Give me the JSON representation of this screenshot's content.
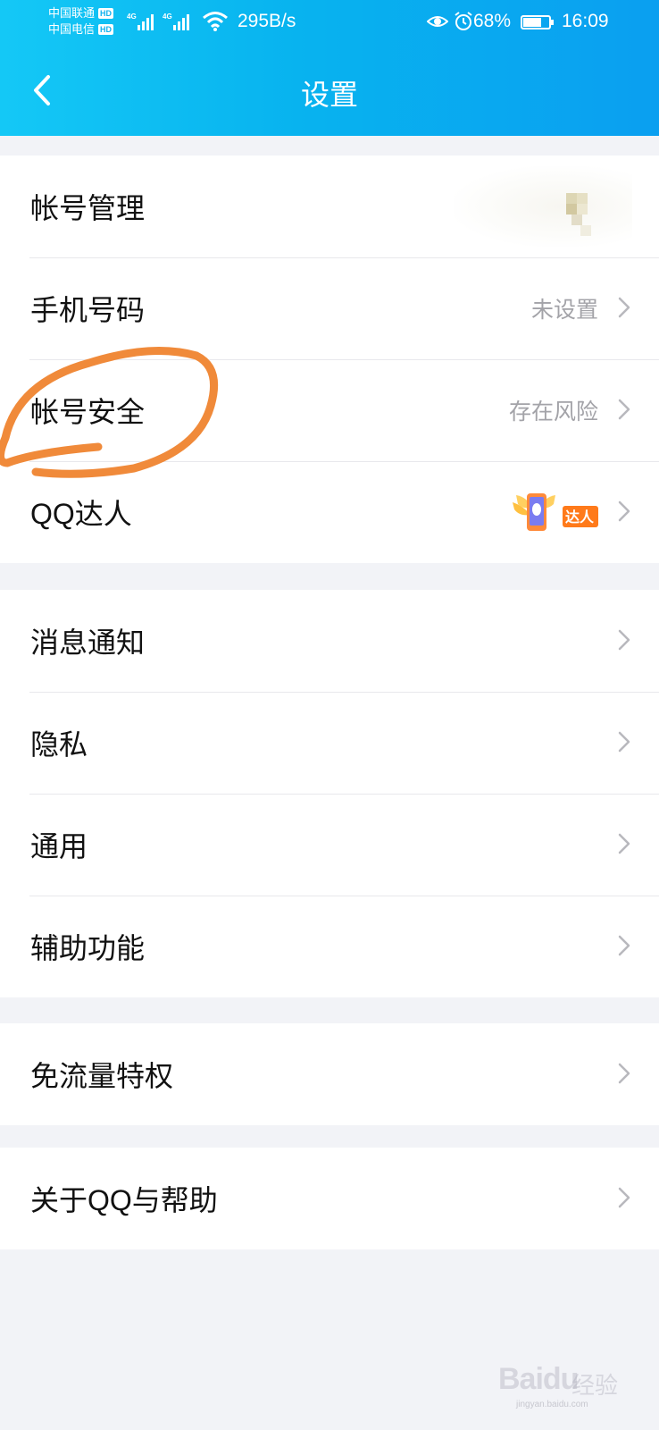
{
  "status_bar": {
    "carrier_1": "中国联通",
    "carrier_2": "中国电信",
    "hd_badge": "HD",
    "network_type": "4G",
    "net_speed": "295B/s",
    "battery_percent": "68%",
    "time": "16:09"
  },
  "header": {
    "title": "设置",
    "back_icon": "chevron-left-icon"
  },
  "groups": [
    {
      "items": [
        {
          "label": "帐号管理",
          "value": ""
        },
        {
          "label": "手机号码",
          "value": "未设置"
        },
        {
          "label": "帐号安全",
          "value": "存在风险"
        },
        {
          "label": "QQ达人",
          "value": "",
          "badge_text": "达人"
        }
      ]
    },
    {
      "items": [
        {
          "label": "消息通知",
          "value": ""
        },
        {
          "label": "隐私",
          "value": ""
        },
        {
          "label": "通用",
          "value": ""
        },
        {
          "label": "辅助功能",
          "value": ""
        }
      ]
    },
    {
      "items": [
        {
          "label": "免流量特权",
          "value": ""
        }
      ]
    },
    {
      "items": [
        {
          "label": "关于QQ与帮助",
          "value": ""
        }
      ]
    }
  ],
  "watermark": {
    "brand": "Baidu",
    "brand_cn": "经验",
    "url": "jingyan.baidu.com"
  },
  "colors": {
    "header_start": "#14c8f6",
    "header_end": "#0a9ff0",
    "annotation_circle": "#f08a3a",
    "value_text": "#a3a3a8",
    "page_background": "#f2f3f7"
  }
}
